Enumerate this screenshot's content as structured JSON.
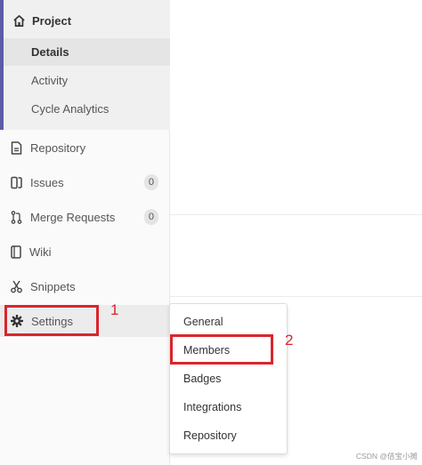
{
  "sidebar": {
    "project": {
      "label": "Project",
      "icon": "home-icon",
      "items": [
        {
          "label": "Details",
          "active": true
        },
        {
          "label": "Activity",
          "active": false
        },
        {
          "label": "Cycle Analytics",
          "active": false
        }
      ]
    },
    "items": [
      {
        "label": "Repository",
        "icon": "document-icon"
      },
      {
        "label": "Issues",
        "icon": "issues-icon",
        "count": "0"
      },
      {
        "label": "Merge Requests",
        "icon": "merge-request-icon",
        "count": "0"
      },
      {
        "label": "Wiki",
        "icon": "book-icon"
      },
      {
        "label": "Snippets",
        "icon": "scissors-icon"
      },
      {
        "label": "Settings",
        "icon": "gear-icon"
      }
    ]
  },
  "settings_menu": {
    "items": [
      "General",
      "Members",
      "Badges",
      "Integrations",
      "Repository"
    ]
  },
  "annotations": {
    "step1": "1",
    "step2": "2",
    "color": "#d9262c"
  },
  "watermark": "CSDN @佶宝小摊",
  "colors": {
    "accent": "#5c5ca8",
    "active_bg": "#e5e5e5"
  }
}
